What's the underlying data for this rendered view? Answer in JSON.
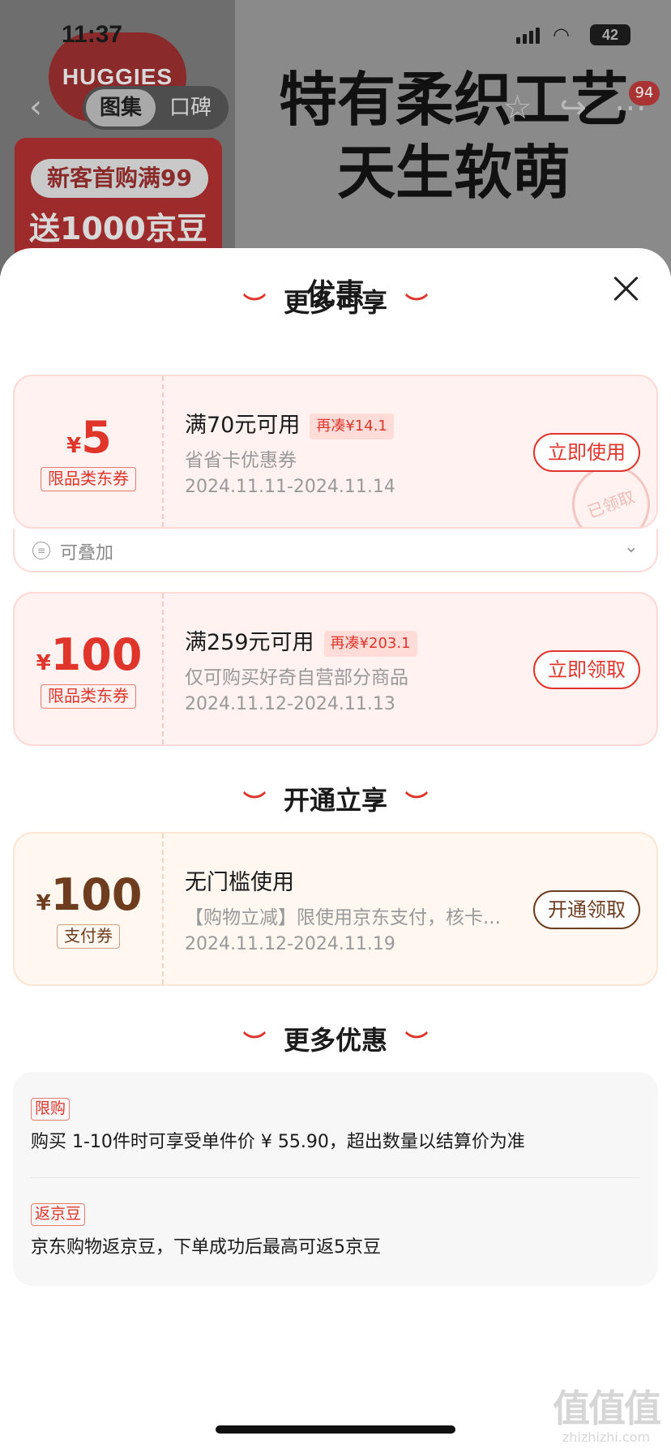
{
  "status": {
    "time": "11:37",
    "battery": "42"
  },
  "background": {
    "brand": "HUGGIES",
    "tabs": [
      "图集",
      "口碑"
    ],
    "hero_lines": [
      "特有柔织工艺",
      "天生软萌"
    ],
    "badge": "94",
    "promo_line1": "新客首购满99",
    "promo_line2": "送1000京豆"
  },
  "sheet": {
    "title": "优惠",
    "section1": "更多可享",
    "section2": "开通立享",
    "section3": "更多优惠",
    "coupons": [
      {
        "currency": "¥",
        "amount": "5",
        "tag": "限品类东券",
        "title": "满70元可用",
        "chip": "再凑¥14.1",
        "subtitle": "省省卡优惠券",
        "date": "2024.11.11-2024.11.14",
        "button": "立即使用",
        "stamp": "已领取",
        "stack_label": "可叠加"
      },
      {
        "currency": "¥",
        "amount": "100",
        "tag": "限品类东券",
        "title": "满259元可用",
        "chip": "再凑¥203.1",
        "subtitle": "仅可购买好奇自营部分商品",
        "date": "2024.11.12-2024.11.13",
        "button": "立即领取"
      },
      {
        "currency": "¥",
        "amount": "100",
        "tag": "支付券",
        "title": "无门槛使用",
        "subtitle": "【购物立减】限使用京东支付，核卡...",
        "date": "2024.11.12-2024.11.19",
        "button": "开通领取"
      }
    ],
    "more": [
      {
        "tag": "限购",
        "text": "购买 1-10件时可享受单件价 ¥ 55.90，超出数量以结算价为准"
      },
      {
        "tag": "返京豆",
        "text": "京东购物返京豆，下单成功后最高可返5京豆"
      }
    ]
  },
  "watermark": {
    "main": "值值值",
    "sub": "zhizhizhi.com"
  },
  "colors": {
    "accent": "#e0352b",
    "gold": "#6e3c1f",
    "coupon_bg": "#fff2f1"
  }
}
